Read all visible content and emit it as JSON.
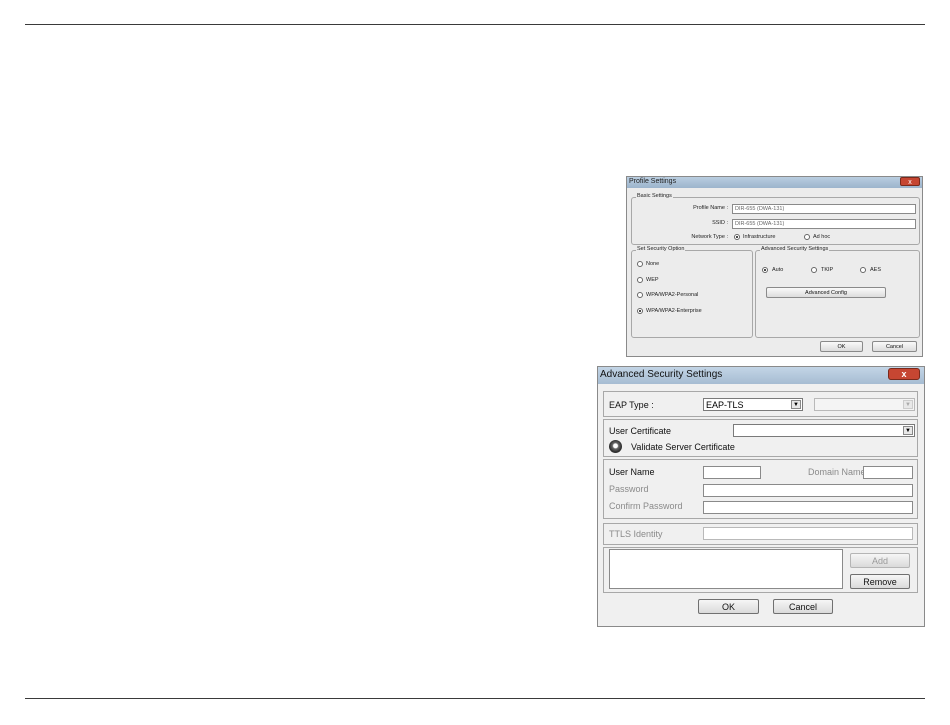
{
  "profile_dialog": {
    "title": "Profile Settings",
    "close_glyph": "x",
    "basic_settings": {
      "legend": "Basic Settings",
      "profile_name_label": "Profile Name :",
      "profile_name_value": "DIR-655 (DWA-131)",
      "ssid_label": "SSID :",
      "ssid_value": "DIR-655 (DWA-131)",
      "network_type_label": "Network Type :",
      "network_types": [
        {
          "label": "Infrastructure",
          "selected": true
        },
        {
          "label": "Ad hoc",
          "selected": false
        }
      ]
    },
    "security_option": {
      "legend": "Set Security Option",
      "options": [
        {
          "label": "None",
          "selected": false
        },
        {
          "label": "WEP",
          "selected": false
        },
        {
          "label": "WPA/WPA2-Personal",
          "selected": false
        },
        {
          "label": "WPA/WPA2-Enterprise",
          "selected": true
        }
      ]
    },
    "advanced_security": {
      "legend": "Advanced Security Settings",
      "ciphers": [
        {
          "label": "Auto",
          "selected": true
        },
        {
          "label": "TKIP",
          "selected": false
        },
        {
          "label": "AES",
          "selected": false
        }
      ],
      "advanced_config_label": "Advanced Config"
    },
    "ok_label": "OK",
    "cancel_label": "Cancel"
  },
  "advanced_dialog": {
    "title": "Advanced Security Settings",
    "close_glyph": "x",
    "eap_type_label": "EAP Type :",
    "eap_type_value": "EAP-TLS",
    "eap_inner_value": "",
    "user_certificate_label": "User Certificate",
    "user_certificate_value": "",
    "validate_server_label": "Validate Server Certificate",
    "user_name_label": "User Name",
    "domain_name_label": "Domain Name",
    "password_label": "Password",
    "confirm_password_label": "Confirm Password",
    "ttls_identity_label": "TTLS Identity",
    "add_label": "Add",
    "remove_label": "Remove",
    "ok_label": "OK",
    "cancel_label": "Cancel"
  },
  "colors": {
    "titlebar": "#a6bcd2",
    "close_button": "#c64632",
    "dialog_bg": "#f0f0f0"
  }
}
